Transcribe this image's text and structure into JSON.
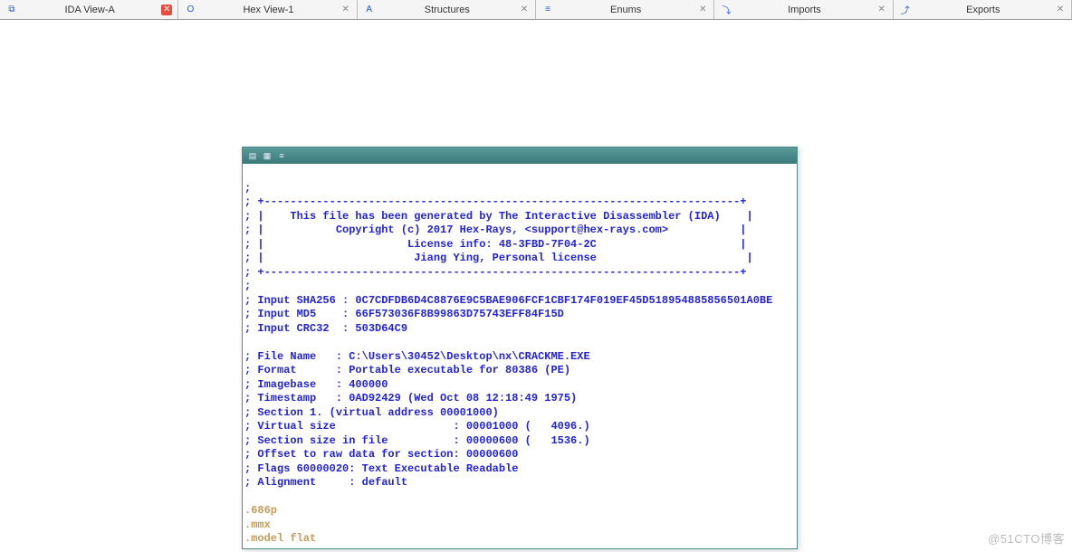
{
  "tabs": [
    {
      "label": "IDA View-A",
      "icon": "⧉",
      "active": true
    },
    {
      "label": "Hex View-1",
      "icon": "O",
      "active": false
    },
    {
      "label": "Structures",
      "icon": "A",
      "active": false
    },
    {
      "label": "Enums",
      "icon": "≡",
      "active": false
    },
    {
      "label": "Imports",
      "icon": "⤵",
      "active": false
    },
    {
      "label": "Exports",
      "icon": "⤴",
      "active": false
    }
  ],
  "code": {
    "border": "; +-------------------------------------------------------------------------+",
    "l1": "; |    This file has been generated by The Interactive Disassembler (IDA)    |",
    "l2": "; |           Copyright (c) 2017 Hex-Rays, <support@hex-rays.com>           |",
    "l3": "; |                      License info: 48-3FBD-7F04-2C                      |",
    "l4": "; |                       Jiang Ying, Personal license                       |",
    "hash1": "; Input SHA256 : 0C7CDFDB6D4C8876E9C5BAE906FCF1CBF174F019EF45D518954885856501A0BE",
    "hash2": "; Input MD5    : 66F573036F8B99863D75743EFF84F15D",
    "hash3": "; Input CRC32  : 503D64C9",
    "f1": "; File Name   : C:\\Users\\30452\\Desktop\\nx\\CRACKME.EXE",
    "f2": "; Format      : Portable executable for 80386 (PE)",
    "f3": "; Imagebase   : 400000",
    "f4": "; Timestamp   : 0AD92429 (Wed Oct 08 12:18:49 1975)",
    "f5": "; Section 1. (virtual address 00001000)",
    "f6": "; Virtual size                  : 00001000 (   4096.)",
    "f7": "; Section size in file          : 00000600 (   1536.)",
    "f8": "; Offset to raw data for section: 00000600",
    "f9": "; Flags 60000020: Text Executable Readable",
    "f10": "; Alignment     : default",
    "d1": ".686p",
    "d2": ".mmx",
    "d3": ".model flat"
  },
  "watermark": "@51CTO博客"
}
